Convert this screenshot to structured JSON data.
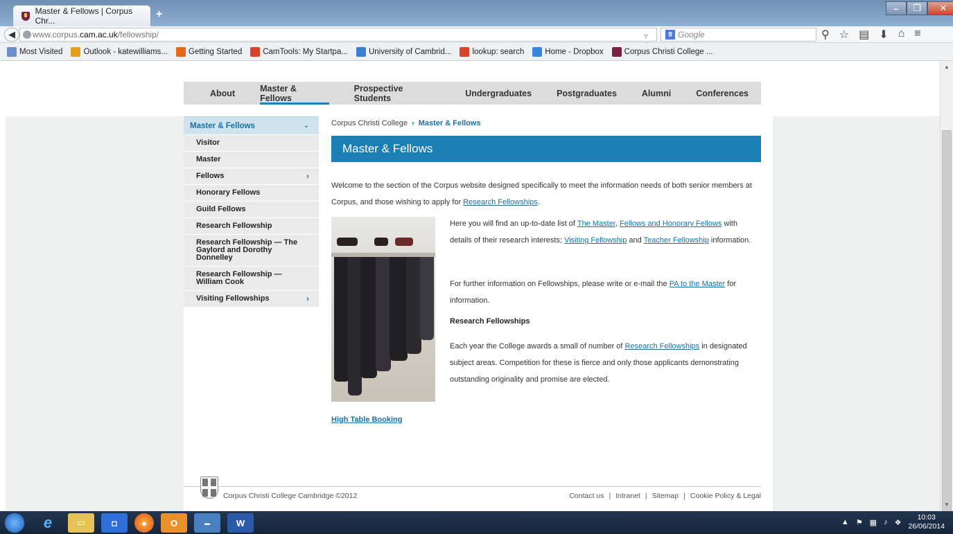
{
  "browser": {
    "tab_title": "Master & Fellows | Corpus Chr...",
    "new_tab": "+",
    "url_prefix": "www.corpus.",
    "url_domain": "cam.ac.uk",
    "url_path": "/fellowship/",
    "search_placeholder": "Google",
    "bookmarks": [
      {
        "label": "Most Visited",
        "color": "#6d8fc9"
      },
      {
        "label": "Outlook - katewilliams...",
        "color": "#e2a021"
      },
      {
        "label": "Getting Started",
        "color": "#e36a1b"
      },
      {
        "label": "CamTools: My Startpa...",
        "color": "#d6452a"
      },
      {
        "label": "University of Cambrid...",
        "color": "#3c7fd0"
      },
      {
        "label": "lookup: search",
        "color": "#d6452a"
      },
      {
        "label": "Home - Dropbox",
        "color": "#3a86df"
      },
      {
        "label": "Corpus Christi College ...",
        "color": "#7a2340"
      }
    ]
  },
  "site": {
    "main_nav": [
      "About",
      "Master & Fellows",
      "Prospective Students",
      "Undergraduates",
      "Postgraduates",
      "Alumni",
      "Conferences"
    ],
    "active_nav": "Master & Fellows",
    "sub_nav": {
      "heading": "Master & Fellows",
      "items": [
        {
          "label": "Visitor",
          "arrow": ""
        },
        {
          "label": "Master",
          "arrow": ""
        },
        {
          "label": "Fellows",
          "arrow": "›"
        },
        {
          "label": "Honorary Fellows",
          "arrow": ""
        },
        {
          "label": "Guild Fellows",
          "arrow": ""
        },
        {
          "label": "Research Fellowship",
          "arrow": ""
        },
        {
          "label": "Research Fellowship — The Gaylord and Dorothy Donnelley",
          "arrow": ""
        },
        {
          "label": "Research Fellowship — William Cook",
          "arrow": ""
        },
        {
          "label": "Visiting Fellowships",
          "arrow": "›"
        }
      ]
    },
    "breadcrumb": {
      "root": "Corpus Christi College",
      "sep": "›",
      "current": "Master & Fellows"
    },
    "page_title": "Master & Fellows",
    "intro": {
      "text_before": "Welcome to the section of the Corpus website designed specifically to meet the information needs of both senior members at Corpus, and those wishing to apply for ",
      "link": "Research Fellowships",
      "text_after": "."
    },
    "para2": {
      "t1": "Here you will find an up-to-date list of ",
      "l1": "The Master",
      "t2": ", ",
      "l2": "Fellows and Honorary Fellows",
      "t3": " with details of their research interests; ",
      "l3": "Visiting Fellowship",
      "t4": " and ",
      "l4": "Teacher Fellowship",
      "t5": " information."
    },
    "para3": {
      "t1": "For further information on Fellowships, please write or e-mail the ",
      "l1": "PA to the Master",
      "t2": " for information."
    },
    "research_heading": "Research Fellowships",
    "para4": {
      "t1": "Each year the College awards a small of number of ",
      "l1": "Research Fellowships",
      "t2": " in designated subject areas. Competition for these is fierce and only those applicants demonstrating outstanding originality and promise are elected."
    },
    "high_table": "High Table Booking",
    "footer": {
      "copyright": "Corpus Christi College Cambridge ©2012",
      "links": [
        "Contact us",
        "|",
        "Intranet",
        "|",
        "Sitemap",
        "|",
        "Cookie Policy & Legal"
      ]
    }
  },
  "taskbar": {
    "time": "10:03",
    "date": "26/06/2014"
  }
}
